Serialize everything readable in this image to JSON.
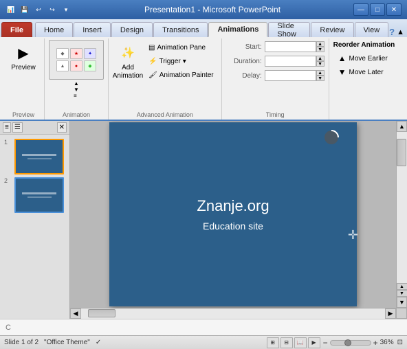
{
  "titlebar": {
    "title": "Presentation1 - Microsoft PowerPoint",
    "minimize": "—",
    "maximize": "□",
    "close": "✕"
  },
  "quickaccess": {
    "save": "💾",
    "undo": "↩",
    "redo": "↪"
  },
  "tabs": [
    {
      "label": "File",
      "type": "file"
    },
    {
      "label": "Home"
    },
    {
      "label": "Insert"
    },
    {
      "label": "Design"
    },
    {
      "label": "Transitions"
    },
    {
      "label": "Animations",
      "active": true
    },
    {
      "label": "Slide Show"
    },
    {
      "label": "Review"
    },
    {
      "label": "View"
    }
  ],
  "ribbon": {
    "groups": [
      {
        "label": "Preview",
        "buttons": [
          {
            "label": "Preview",
            "icon": "▶"
          }
        ]
      },
      {
        "label": "Animation",
        "buttons": [
          {
            "label": "Animation",
            "icon": "✨"
          }
        ]
      },
      {
        "label": "Advanced Animation",
        "items": [
          {
            "label": "Add Animation",
            "icon": "＋✨"
          },
          {
            "label": "Animation Pane",
            "icon": "▤"
          },
          {
            "label": "Trigger",
            "icon": "⚡"
          },
          {
            "label": "Animation Painter",
            "icon": "🖌"
          }
        ]
      },
      {
        "label": "Timing",
        "start_label": "Start:",
        "duration_label": "Duration:",
        "delay_label": "Delay:"
      },
      {
        "label": "Reorder Animation",
        "move_earlier": "Move Earlier",
        "move_later": "Move Later"
      }
    ]
  },
  "slides": [
    {
      "num": "1",
      "selected": true
    },
    {
      "num": "2",
      "selected": false
    }
  ],
  "slide": {
    "title": "Znanje.org",
    "subtitle": "Education site"
  },
  "statusbar": {
    "slide_info": "Slide 1 of 2",
    "theme": "\"Office Theme\"",
    "zoom": "36%"
  },
  "notebar": {
    "text": "C"
  }
}
